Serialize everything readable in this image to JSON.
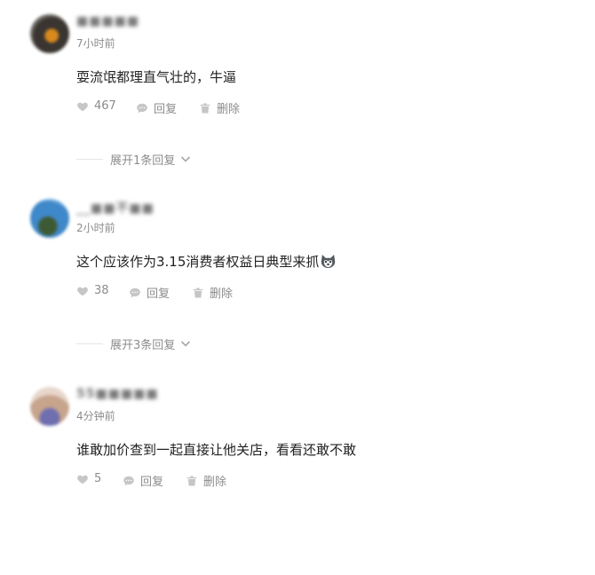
{
  "comments": [
    {
      "username": "■■■■■",
      "time": "7小时前",
      "text": "耍流氓都理直气壮的，牛逼",
      "likes": "467",
      "reply_label": "回复",
      "delete_label": "删除",
      "expand_label": "展开1条回复"
    },
    {
      "username": "__■■不■■",
      "time": "2小时前",
      "text": "这个应该作为3.15消费者权益日典型来抓",
      "likes": "38",
      "reply_label": "回复",
      "delete_label": "删除",
      "expand_label": "展开3条回复"
    },
    {
      "username": "55■■■■■",
      "time": "4分钟前",
      "text": "谁敢加价查到一起直接让他关店，看看还敢不敢",
      "likes": "5",
      "reply_label": "回复",
      "delete_label": "删除"
    }
  ],
  "icons": {
    "like": "heart-icon",
    "reply": "speech-bubble-icon",
    "delete": "trash-icon",
    "expand": "chevron-down-icon",
    "emoji": "husky-emoji-icon"
  },
  "colors": {
    "text": "#222222",
    "muted": "#8c8c8c",
    "icon": "#c6c6c6"
  }
}
